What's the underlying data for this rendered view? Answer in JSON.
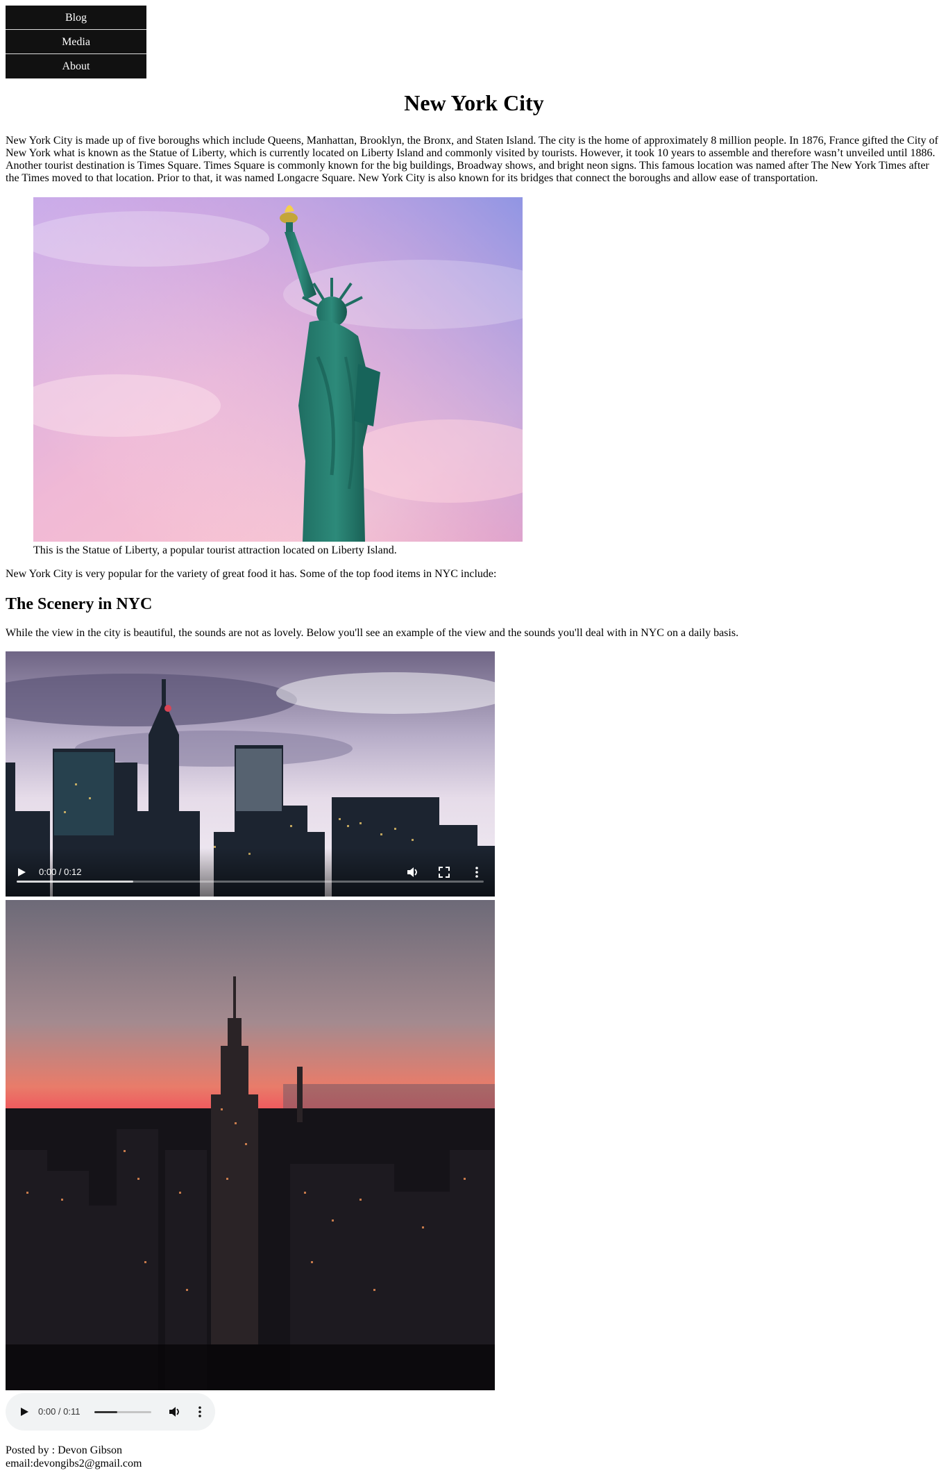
{
  "nav": {
    "items": [
      {
        "label": "Blog"
      },
      {
        "label": "Media"
      },
      {
        "label": "About"
      }
    ]
  },
  "page": {
    "title": "New York City",
    "intro": "New York City is made up of five boroughs which include Queens, Manhattan, Brooklyn, the Bronx, and Staten Island. The city is the home of approximately 8 million people. In 1876, France gifted the City of New York what is known as the Statue of Liberty, which is currently located on Liberty Island and commonly visited by tourists. However, it took 10 years to assemble and therefore wasn’t unveiled until 1886. Another tourist destination is Times Square. Times Square is commonly known for the big buildings, Broadway shows, and bright neon signs. This famous location was named after The New York Times after the Times moved to that location. Prior to that, it was named Longacre Square. New York City is also known for its bridges that connect the boroughs and allow ease of transportation.",
    "statue_caption": "This is the Statue of Liberty, a popular tourist attraction located on Liberty Island.",
    "food_text": "New York City is very popular for the variety of great food it has. Some of the top food items in NYC include:",
    "scenery_heading": "The Scenery in NYC",
    "scenery_text": "While the view in the city is beautiful, the sounds are not as lovely. Below you'll see an example of the view and the sounds you'll deal with in NYC on a daily basis."
  },
  "video": {
    "time": "0:00 / 0:12",
    "progress_fraction": 0.25,
    "icons": [
      "play-icon",
      "volume-icon",
      "fullscreen-icon",
      "more-options-icon"
    ]
  },
  "audio": {
    "time": "0:00 / 0:11",
    "volume_fraction": 0.4,
    "icons": [
      "play-icon",
      "volume-icon",
      "more-options-icon"
    ]
  },
  "footer": {
    "posted_by": "Posted by : Devon Gibson",
    "email": "email:devongibs2@gmail.com"
  },
  "colors": {
    "nav_background": "#111111",
    "nav_text": "#ffffff",
    "audio_background": "#f1f3f4"
  }
}
